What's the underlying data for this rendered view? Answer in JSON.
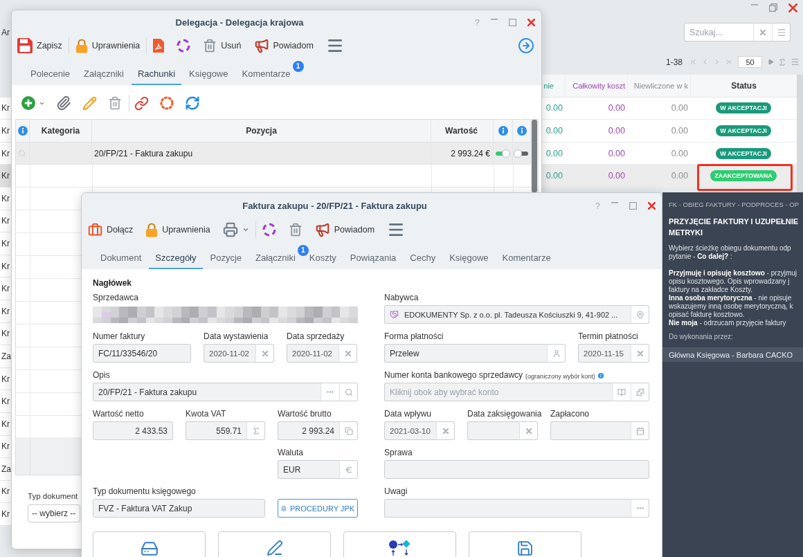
{
  "background": {
    "toolbar_text": "Ar",
    "search": {
      "placeholder": "Szukaj..."
    },
    "pager": {
      "range": "1-38",
      "page_size": "50"
    },
    "table": {
      "columns": [
        {
          "label": "nie",
          "color": "#2a9d8f"
        },
        {
          "label": "Całkowity koszt",
          "color": "#9b45b3"
        },
        {
          "label": "Niewliczone w k",
          "color": "#8c8c8c"
        },
        {
          "label": "Status",
          "color": "#333333"
        }
      ],
      "rows": [
        {
          "cell_1": "Kr",
          "selected": false,
          "values": [
            "0.00",
            "0.00",
            "0.00"
          ],
          "status": {
            "label": "W AKCEPTACJI",
            "color": "#1a9a7b",
            "highlighted": false
          }
        },
        {
          "cell_1": "Kr",
          "selected": false,
          "values": [
            "0.00",
            "0.00",
            "0.00"
          ],
          "status": {
            "label": "W AKCEPTACJI",
            "color": "#1a9a7b",
            "highlighted": false
          }
        },
        {
          "cell_1": "Kr",
          "selected": false,
          "values": [
            "0.00",
            "0.00",
            "0.00"
          ],
          "status": {
            "label": "W AKCEPTACJI",
            "color": "#1a9a7b",
            "highlighted": false
          }
        },
        {
          "cell_1": "Kr",
          "selected": true,
          "values": [
            "0.00",
            "0.00",
            "0.00"
          ],
          "status": {
            "label": "ZAAKCEPTOWANA",
            "color": "#2ecc71",
            "highlighted": true
          }
        },
        {
          "cell_1": "Kr",
          "selected": false
        },
        {
          "cell_1": "Kr",
          "selected": false
        },
        {
          "cell_1": "Kr",
          "selected": false
        },
        {
          "cell_1": "Kr",
          "selected": false
        },
        {
          "cell_1": "Kr",
          "selected": false
        },
        {
          "cell_1": "Kr",
          "selected": false
        },
        {
          "cell_1": "Kr",
          "selected": false
        },
        {
          "cell_1": "Za",
          "selected": false
        },
        {
          "cell_1": "Kr",
          "selected": false
        },
        {
          "cell_1": "Kr",
          "selected": false
        },
        {
          "cell_1": "Kr",
          "selected": false
        },
        {
          "cell_1": "Kr",
          "selected": false
        },
        {
          "cell_1": "Za",
          "selected": false
        },
        {
          "cell_1": "Kr",
          "selected": false
        },
        {
          "cell_1": "Kr",
          "selected": false
        }
      ]
    }
  },
  "delegation_window": {
    "title": "Delegacja - Delegacja krajowa",
    "help": "?",
    "toolbar": [
      [
        {
          "kind": "save",
          "label": "Zapisz",
          "dropdown": false
        }
      ],
      [
        {
          "kind": "lock",
          "label": "Uprawnienia",
          "dropdown": false
        }
      ],
      [
        {
          "kind": "pdf",
          "dropdown": false
        },
        {
          "kind": "cycle",
          "dropdown": false
        },
        {
          "kind": "trash",
          "label": "Usuń",
          "dropdown": false
        },
        {
          "kind": "megaphone",
          "label": "Powiadom",
          "dropdown": false
        },
        {
          "kind": "menu",
          "dropdown": false
        }
      ]
    ],
    "tabs": [
      {
        "label": "Polecenie",
        "selected": false
      },
      {
        "label": "Załączniki",
        "selected": false
      },
      {
        "label": "Rachunki",
        "selected": true
      },
      {
        "label": "Księgowe",
        "selected": false
      },
      {
        "label": "Komentarze",
        "selected": false,
        "badge": "1"
      }
    ],
    "table": {
      "columns": [
        "Kategoria",
        "Pozycja",
        "Wartość"
      ],
      "rows": [
        {
          "position": "20/FP/21 - Faktura zakupu",
          "value": "2 993.24 €",
          "toggle_1": true,
          "toggle_2": false,
          "selected": true
        }
      ]
    },
    "footer_field": {
      "label": "Typ dokument",
      "value": "-- wybierz --"
    }
  },
  "invoice_window": {
    "title": "Faktura zakupu - 20/FP/21 - Faktura zakupu",
    "help": "?",
    "toolbar": [
      [
        {
          "kind": "briefcase",
          "label": "Dołącz",
          "dropdown": false
        },
        {
          "kind": "lock",
          "label": "Uprawnienia",
          "dropdown": false
        },
        {
          "kind": "printer",
          "dropdown": true
        }
      ],
      [
        {
          "kind": "cycle",
          "dropdown": false
        },
        {
          "kind": "trash",
          "dropdown": false
        },
        {
          "kind": "megaphone",
          "label": "Powiadom",
          "dropdown": false
        },
        {
          "kind": "menu",
          "dropdown": false
        }
      ]
    ],
    "tabs": [
      {
        "label": "Dokument",
        "selected": false
      },
      {
        "label": "Szczegóły",
        "selected": true
      },
      {
        "label": "Pozycje",
        "selected": false
      },
      {
        "label": "Załączniki",
        "selected": false,
        "badge": "1"
      },
      {
        "label": "Koszty",
        "selected": false
      },
      {
        "label": "Powiązania",
        "selected": false
      },
      {
        "label": "Cechy",
        "selected": false
      },
      {
        "label": "Księgowe",
        "selected": false
      },
      {
        "label": "Komentarze",
        "selected": false
      }
    ],
    "form": {
      "heading": "Nagłówek",
      "seller": {
        "label": "Sprzedawca",
        "redacted": true
      },
      "buyer": {
        "label": "Nabywca",
        "value": "EDOKUMENTY Sp. z o.o. pl. Tadeusza Kościuszki 9, 41-902 ..."
      },
      "invoice_number": {
        "label": "Numer faktury",
        "value": "FC/11/33546/20"
      },
      "issue_date": {
        "label": "Data wystawienia",
        "value": "2020-11-02"
      },
      "sale_date": {
        "label": "Data sprzedaży",
        "value": "2020-11-02"
      },
      "payment_method": {
        "label": "Forma płatności",
        "value": "Przelew"
      },
      "payment_due": {
        "label": "Termin płatności",
        "value": "2020-11-15"
      },
      "description": {
        "label": "Opis",
        "value": "20/FP/21 - Faktura zakupu"
      },
      "bank_account": {
        "label": "Numer konta bankowego sprzedawcy",
        "note": "(ograniczony wybór kont)",
        "placeholder": "Kliknij obok aby wybrać konto"
      },
      "net_value": {
        "label": "Wartość netto",
        "value": "2 433.53"
      },
      "vat_amount": {
        "label": "Kwota VAT",
        "value": "559.71"
      },
      "gross_value": {
        "label": "Wartość brutto",
        "value": "2 993.24"
      },
      "receipt_date": {
        "label": "Data wpływu",
        "value": "2021-03-10"
      },
      "posting_date": {
        "label": "Data zaksięgowania"
      },
      "paid": {
        "label": "Zapłacono"
      },
      "currency": {
        "label": "Waluta",
        "value": "EUR"
      },
      "case": {
        "label": "Sprawa"
      },
      "accounting_doc_type": {
        "label": "Typ dokumentu księgowego",
        "value": "FVZ - Faktura VAT Zakup"
      },
      "jpk_button": "PROCEDURY JPK",
      "notes": {
        "label": "Uwagi"
      }
    }
  },
  "process_panel": {
    "breadcrumb": "FK - OBIEG FAKTURY - PODPROCES - OP",
    "title": "PRZYJĘCIE FAKTURY I UZUPEŁNIE\nMETRYKI",
    "paragraphs": [
      "Wybierz ścieżkę obiegu dokumentu odp\npytanie - **Co dalej?** :",
      "**Przyjmuję i opisuję kosztowo** - przyjmuj\nopisu kosztowego. Opis wprowadzany j\nfaktury na zakładce Koszty.\n**Inna osoba merytoryczna** - nie opisuje\nwskazujemy inną osobę merytoryczną, k\nopisać fakturę kosztowo.\n**Nie moja** - odrzucam przyjęcie faktury"
    ],
    "assignee_label": "Do wykonania przez:",
    "assignee": "Główna Księgowa - Barbara CACKO"
  }
}
